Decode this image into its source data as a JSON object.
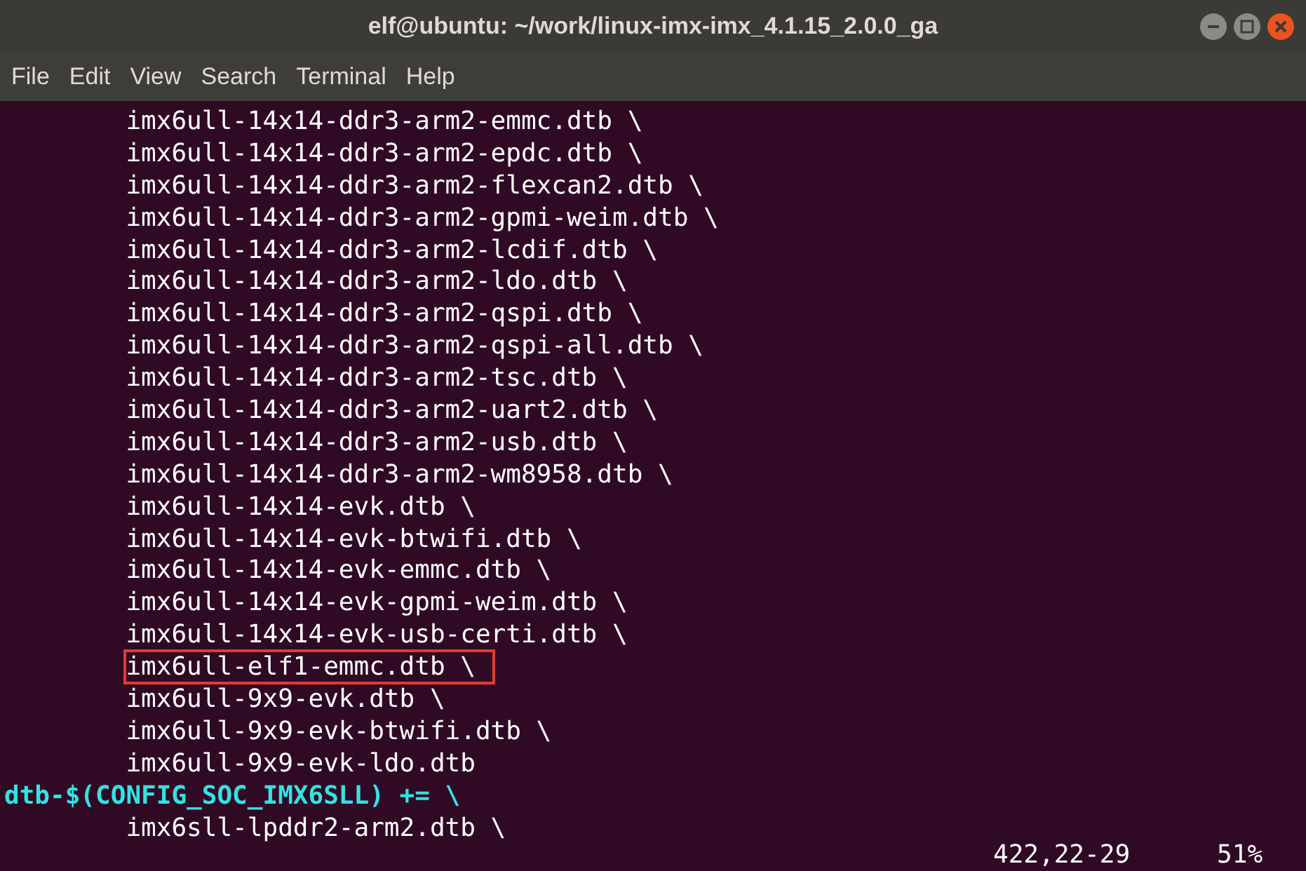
{
  "window": {
    "title": "elf@ubuntu: ~/work/linux-imx-imx_4.1.15_2.0.0_ga"
  },
  "menu": [
    "File",
    "Edit",
    "View",
    "Search",
    "Terminal",
    "Help"
  ],
  "lines": [
    {
      "text": "        imx6ull-14x14-ddr3-arm2-emmc.dtb \\",
      "kind": "plain",
      "highlighted": false
    },
    {
      "text": "        imx6ull-14x14-ddr3-arm2-epdc.dtb \\",
      "kind": "plain",
      "highlighted": false
    },
    {
      "text": "        imx6ull-14x14-ddr3-arm2-flexcan2.dtb \\",
      "kind": "plain",
      "highlighted": false
    },
    {
      "text": "        imx6ull-14x14-ddr3-arm2-gpmi-weim.dtb \\",
      "kind": "plain",
      "highlighted": false
    },
    {
      "text": "        imx6ull-14x14-ddr3-arm2-lcdif.dtb \\",
      "kind": "plain",
      "highlighted": false
    },
    {
      "text": "        imx6ull-14x14-ddr3-arm2-ldo.dtb \\",
      "kind": "plain",
      "highlighted": false
    },
    {
      "text": "        imx6ull-14x14-ddr3-arm2-qspi.dtb \\",
      "kind": "plain",
      "highlighted": false
    },
    {
      "text": "        imx6ull-14x14-ddr3-arm2-qspi-all.dtb \\",
      "kind": "plain",
      "highlighted": false
    },
    {
      "text": "        imx6ull-14x14-ddr3-arm2-tsc.dtb \\",
      "kind": "plain",
      "highlighted": false
    },
    {
      "text": "        imx6ull-14x14-ddr3-arm2-uart2.dtb \\",
      "kind": "plain",
      "highlighted": false
    },
    {
      "text": "        imx6ull-14x14-ddr3-arm2-usb.dtb \\",
      "kind": "plain",
      "highlighted": false
    },
    {
      "text": "        imx6ull-14x14-ddr3-arm2-wm8958.dtb \\",
      "kind": "plain",
      "highlighted": false
    },
    {
      "text": "        imx6ull-14x14-evk.dtb \\",
      "kind": "plain",
      "highlighted": false
    },
    {
      "text": "        imx6ull-14x14-evk-btwifi.dtb \\",
      "kind": "plain",
      "highlighted": false
    },
    {
      "text": "        imx6ull-14x14-evk-emmc.dtb \\",
      "kind": "plain",
      "highlighted": false
    },
    {
      "text": "        imx6ull-14x14-evk-gpmi-weim.dtb \\",
      "kind": "plain",
      "highlighted": false
    },
    {
      "text": "        imx6ull-14x14-evk-usb-certi.dtb \\",
      "kind": "plain",
      "highlighted": false
    },
    {
      "text": "        imx6ull-elf1-emmc.dtb \\",
      "kind": "plain",
      "highlighted": true
    },
    {
      "text": "        imx6ull-9x9-evk.dtb \\",
      "kind": "plain",
      "highlighted": false
    },
    {
      "text": "        imx6ull-9x9-evk-btwifi.dtb \\",
      "kind": "plain",
      "highlighted": false
    },
    {
      "text": "        imx6ull-9x9-evk-ldo.dtb",
      "kind": "plain",
      "highlighted": false
    },
    {
      "text": "dtb-$(CONFIG_SOC_IMX6SLL) += \\",
      "kind": "keyword",
      "highlighted": false
    },
    {
      "text": "        imx6sll-lpddr2-arm2.dtb \\",
      "kind": "plain",
      "highlighted": false
    }
  ],
  "status": {
    "position": "422,22-29",
    "percent": "51%"
  }
}
